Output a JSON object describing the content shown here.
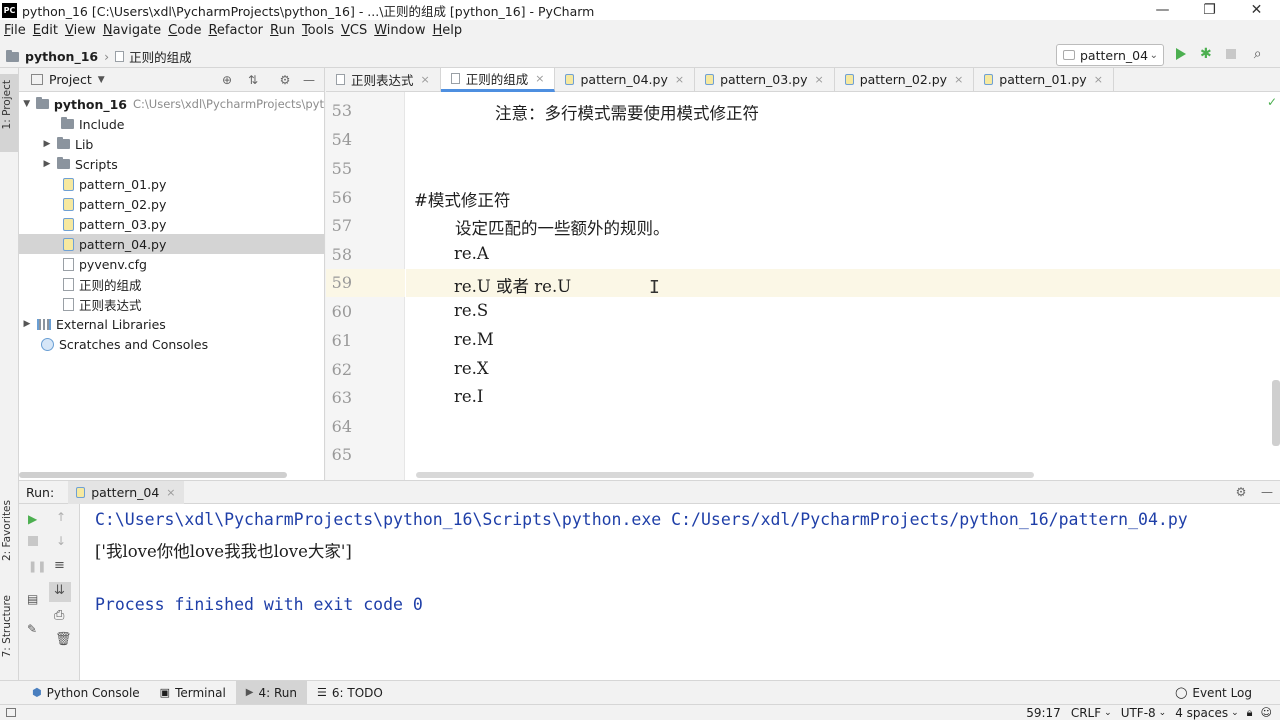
{
  "window": {
    "title": "python_16 [C:\\Users\\xdl\\PycharmProjects\\python_16] - ...\\正则的组成 [python_16] - PyCharm",
    "logo": "PC"
  },
  "menu": [
    "File",
    "Edit",
    "View",
    "Navigate",
    "Code",
    "Refactor",
    "Run",
    "Tools",
    "VCS",
    "Window",
    "Help"
  ],
  "breadcrumb": {
    "project": "python_16",
    "file": "正则的组成"
  },
  "run_config": {
    "selected": "pattern_04"
  },
  "project_panel": {
    "header": "Project",
    "root": {
      "name": "python_16",
      "path": "C:\\Users\\xdl\\PycharmProjects\\pyt"
    },
    "items": [
      {
        "label": "Include"
      },
      {
        "label": "Lib"
      },
      {
        "label": "Scripts"
      },
      {
        "label": "pattern_01.py"
      },
      {
        "label": "pattern_02.py"
      },
      {
        "label": "pattern_03.py"
      },
      {
        "label": "pattern_04.py"
      },
      {
        "label": "pyvenv.cfg"
      },
      {
        "label": "正则的组成"
      },
      {
        "label": "正则表达式"
      },
      {
        "label": "External Libraries"
      },
      {
        "label": "Scratches and Consoles"
      }
    ]
  },
  "editor": {
    "tabs": [
      "正则表达式",
      "正则的组成",
      "pattern_04.py",
      "pattern_03.py",
      "pattern_02.py",
      "pattern_01.py"
    ],
    "active_tab": "正则的组成",
    "lines": [
      {
        "num": "53",
        "text": "注意：多行模式需要使用模式修正符"
      },
      {
        "num": "54",
        "text": ""
      },
      {
        "num": "55",
        "text": ""
      },
      {
        "num": "56",
        "text": "#模式修正符"
      },
      {
        "num": "57",
        "text": "设定匹配的一些额外的规则。"
      },
      {
        "num": "58",
        "text": "re.A"
      },
      {
        "num": "59",
        "text": "re.U 或者 re.U"
      },
      {
        "num": "60",
        "text": "re.S"
      },
      {
        "num": "61",
        "text": "re.M"
      },
      {
        "num": "62",
        "text": "re.X"
      },
      {
        "num": "63",
        "text": "re.I"
      },
      {
        "num": "64",
        "text": ""
      },
      {
        "num": "65",
        "text": ""
      }
    ]
  },
  "run_panel": {
    "label": "Run:",
    "tab": "pattern_04",
    "output": [
      "C:\\Users\\xdl\\PycharmProjects\\python_16\\Scripts\\python.exe C:/Users/xdl/PycharmProjects/python_16/pattern_04.py",
      "['我love你他love我我也love大家']",
      "Process finished with exit code 0"
    ]
  },
  "side_tabs": {
    "project": "1: Project",
    "favorites": "2: Favorites",
    "structure": "7: Structure"
  },
  "bottom_tabs": [
    "Python Console",
    "Terminal",
    "4: Run",
    "6: TODO"
  ],
  "event_log": "Event Log",
  "status": {
    "position": "59:17",
    "line_sep": "CRLF",
    "encoding": "UTF-8",
    "indent": "4 spaces"
  }
}
